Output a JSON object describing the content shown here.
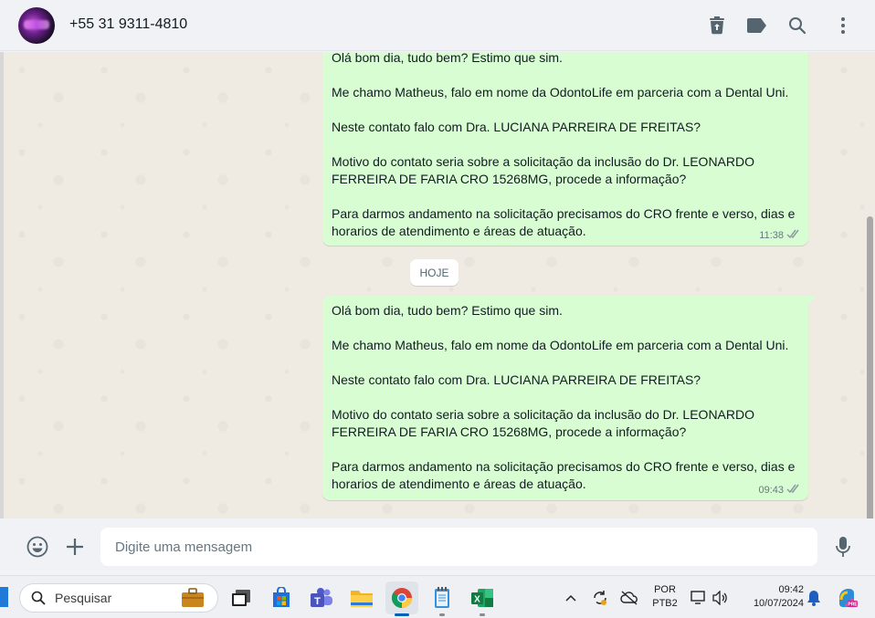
{
  "header": {
    "contact_name": "+55 31 9311-4810",
    "icons": [
      "delete-icon",
      "label-icon",
      "search-icon",
      "menu-icon"
    ]
  },
  "messages": [
    {
      "text": "Olá bom dia, tudo bem? Estimo que sim.\n\nMe chamo Matheus, falo em nome da OdontoLife em parceria com a Dental Uni.\n\nNeste contato falo com Dra. LUCIANA PARREIRA DE FREITAS?\n\nMotivo do contato seria sobre a solicitação da inclusão do Dr. LEONARDO\nFERREIRA DE FARIA CRO 15268MG, procede a informação?\n\nPara darmos andamento na solicitação precisamos do CRO frente e verso, dias e\nhorarios de atendimento e áreas de atuação.",
      "time": "11:38",
      "status": "read"
    },
    {
      "text": "Olá bom dia, tudo bem? Estimo que sim.\n\nMe chamo Matheus, falo em nome da OdontoLife em parceria com a Dental Uni.\n\nNeste contato falo com Dra. LUCIANA PARREIRA DE FREITAS?\n\nMotivo do contato seria sobre a solicitação da inclusão do Dr. LEONARDO\nFERREIRA DE FARIA CRO 15268MG, procede a informação?\n\nPara darmos andamento na solicitação precisamos do CRO frente e verso, dias e\nhorarios de atendimento e áreas de atuação.",
      "time": "09:43",
      "status": "read"
    }
  ],
  "date_separator": "HOJE",
  "composer": {
    "placeholder": "Digite uma mensagem",
    "icons": [
      "emoji-icon",
      "attach-plus-icon",
      "microphone-icon"
    ]
  },
  "taskbar": {
    "search_placeholder": "Pesquisar",
    "apps": [
      "work-briefcase",
      "task-view",
      "microsoft-store",
      "teams",
      "file-explorer",
      "chrome",
      "notepad",
      "excel"
    ],
    "tray": {
      "language": "POR",
      "layout": "PTB2",
      "time": "09:42",
      "date": "10/07/2024"
    }
  },
  "colors": {
    "bubble_out": "#d9fdd3",
    "chat_bg": "#efeae2",
    "panel_bg": "#f0f2f5",
    "read_tick": "#8a9aa3"
  }
}
